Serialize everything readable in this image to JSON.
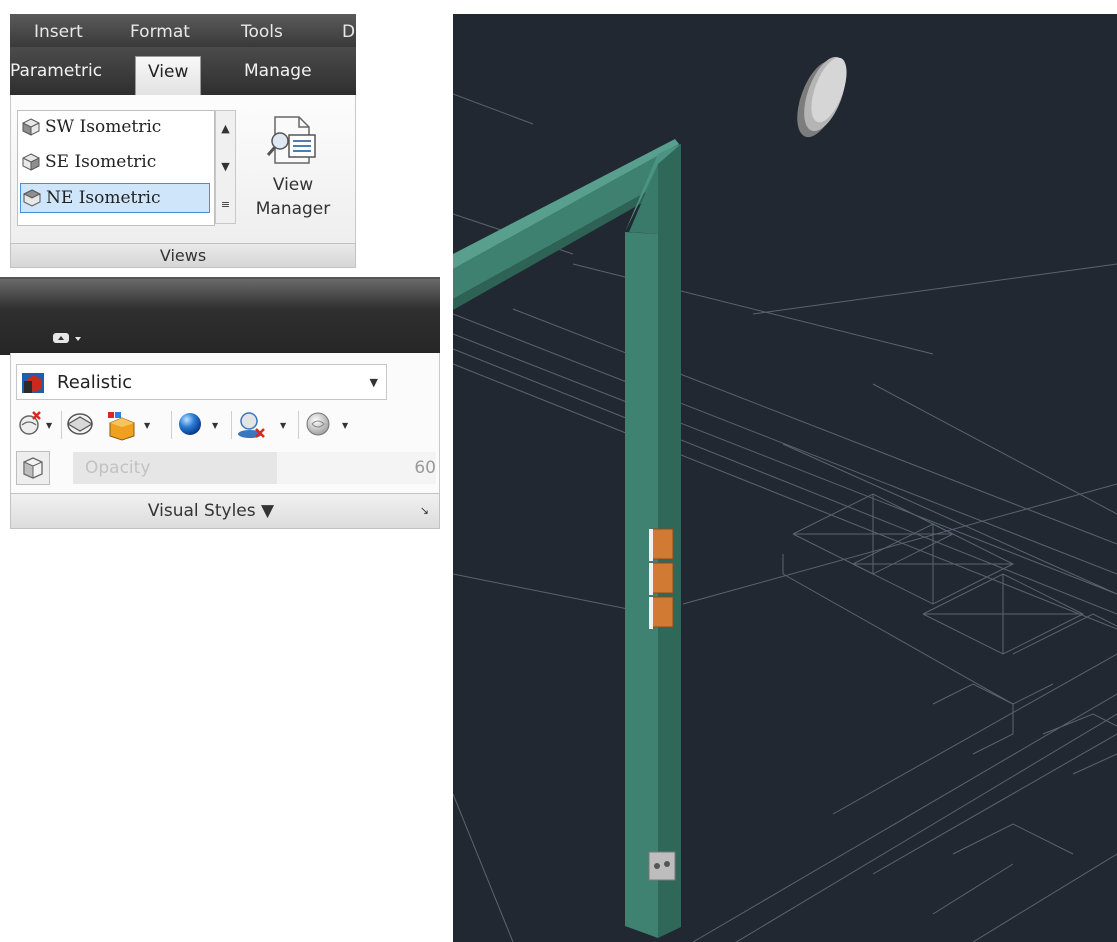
{
  "menubar": {
    "items": [
      "Insert",
      "Format",
      "Tools",
      "D"
    ]
  },
  "ribbon_tabs": {
    "items": [
      "Parametric",
      "View",
      "Manage"
    ],
    "active": "View"
  },
  "views_panel": {
    "list": [
      "SW Isometric",
      "SE Isometric",
      "NE Isometric"
    ],
    "selected": "NE Isometric",
    "view_manager_line1": "View",
    "view_manager_line2": "Manager",
    "footer": "Views"
  },
  "visual_styles_panel": {
    "current_style": "Realistic",
    "opacity_label": "Opacity",
    "opacity_value": "60",
    "opacity_fraction": 0.6,
    "footer": "Visual Styles ▼",
    "launcher": "↘"
  },
  "colors": {
    "viewport_bg": "#212831",
    "frame_green": "#3f8272",
    "outlet_orange": "#cf7a32",
    "selection_blue": "#cfe6fa"
  },
  "icons": {
    "view_cube": "isometric-cube-icon",
    "view_manager": "view-manager-icon",
    "realistic_style": "realistic-style-icon",
    "tools": [
      "x-ray-icon",
      "face-style-icon",
      "material-icon",
      "lighting-sphere-icon",
      "shadow-icon",
      "environment-icon"
    ]
  }
}
